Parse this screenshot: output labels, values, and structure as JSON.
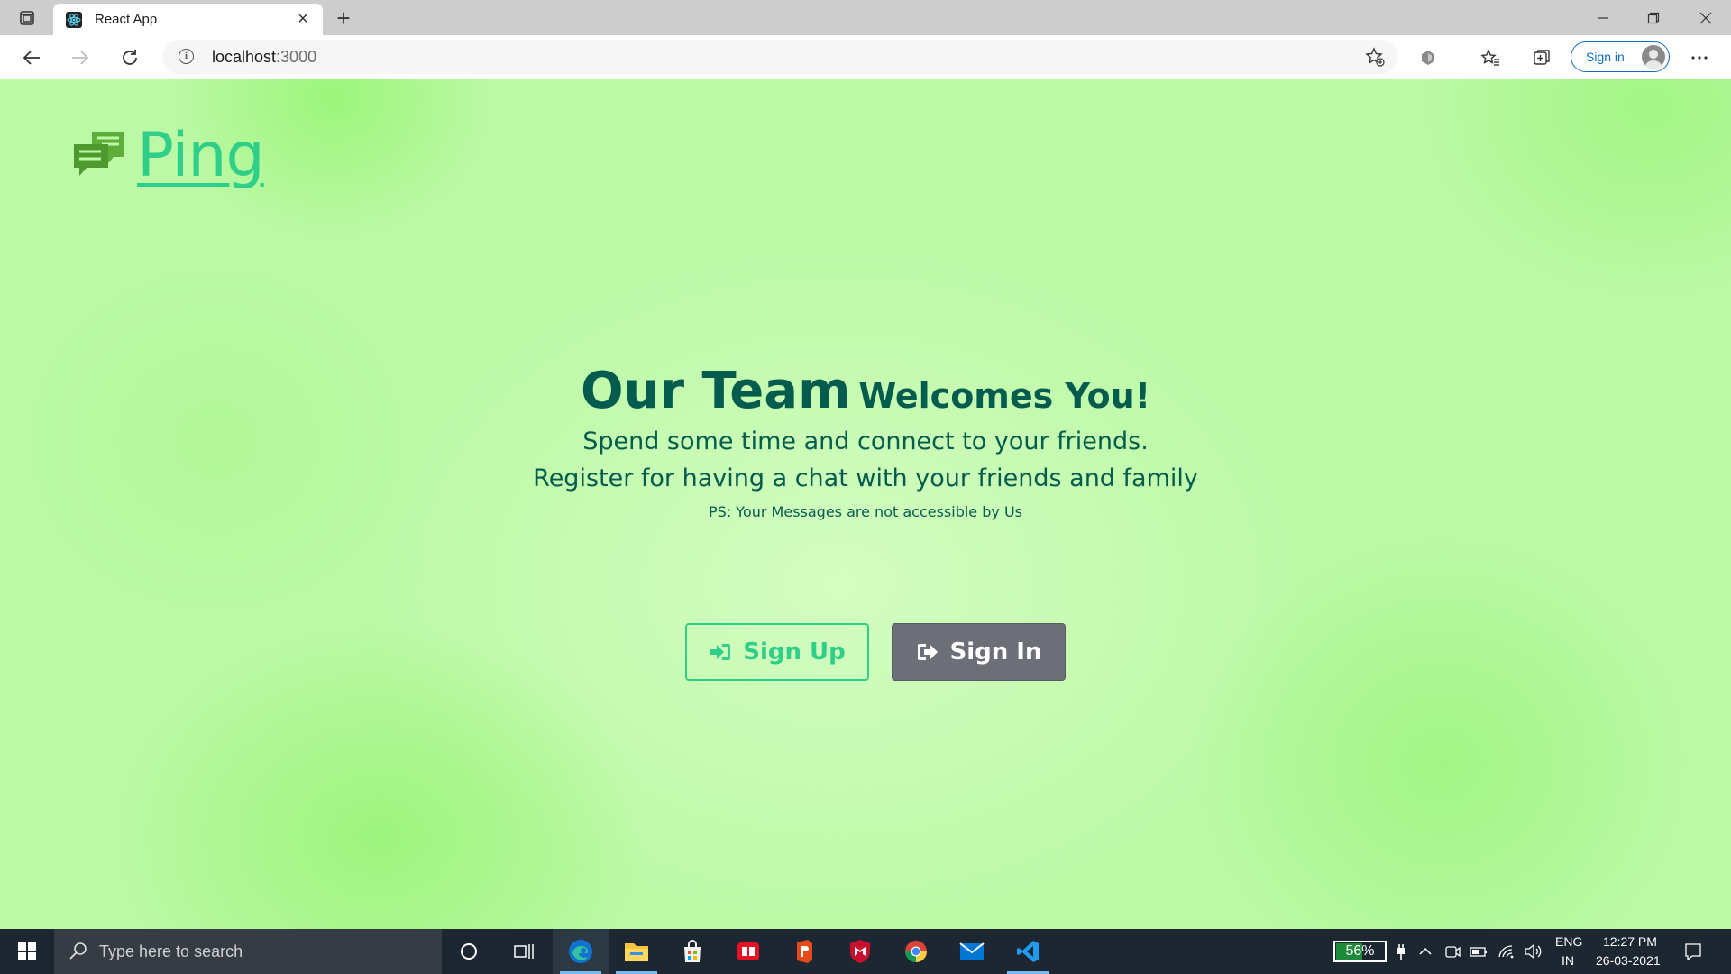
{
  "browser": {
    "tab_title": "React App",
    "url_host": "localhost",
    "url_port": ":3000",
    "signin_label": "Sign in"
  },
  "page": {
    "logo_text": "Ping",
    "headline_big": "Our Team",
    "headline_small": "Welcomes You!",
    "line1": "Spend some time and connect to your friends.",
    "line2": "Register for having a chat with your friends and family",
    "ps": "PS: Your Messages are not accessible by Us",
    "signup_label": "Sign Up",
    "signin_label": "Sign In",
    "colors": {
      "accent": "#2fcf8a",
      "heading": "#045c4e",
      "signin_bg": "#6d6f78",
      "logo_icon": "#5fae3a"
    }
  },
  "taskbar": {
    "search_placeholder": "Type here to search",
    "battery_percent": 56,
    "battery_label": "56%",
    "language": "ENG",
    "region": "IN",
    "time": "12:27 PM",
    "date": "26-03-2021",
    "pinned": [
      "cortana-icon",
      "task-view-icon",
      "edge-icon",
      "file-explorer-icon",
      "store-icon",
      "reader-icon",
      "office-icon",
      "mcafee-icon",
      "chrome-icon",
      "mail-icon",
      "vscode-icon"
    ]
  }
}
